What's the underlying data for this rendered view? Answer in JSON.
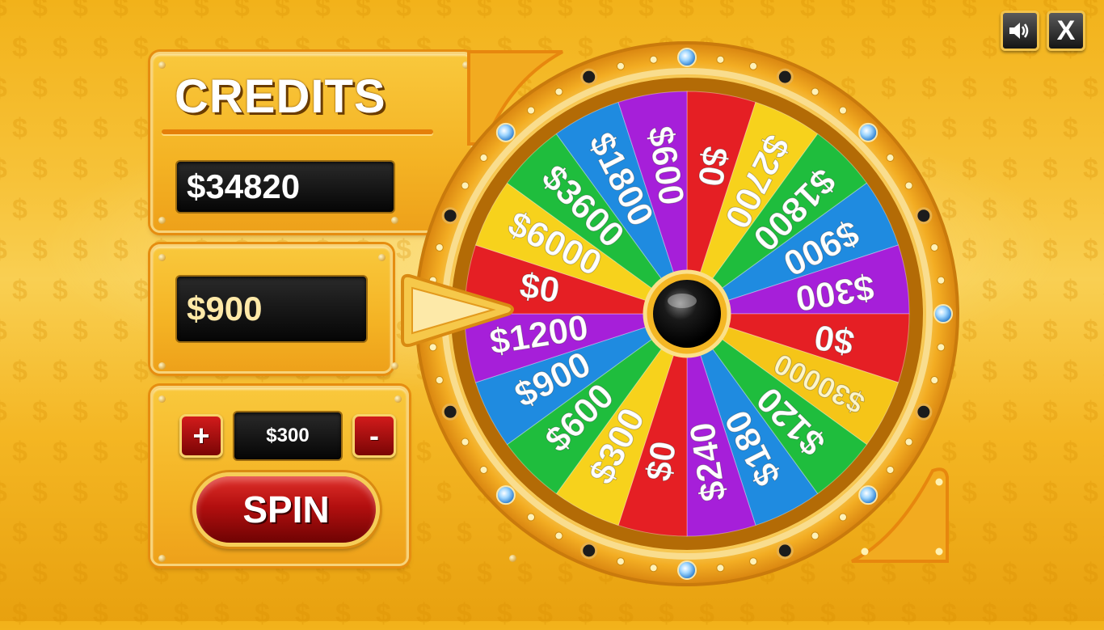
{
  "toolbar": {
    "sound_icon": "speaker-icon",
    "close_label": "X"
  },
  "credits_panel": {
    "title": "CREDITS",
    "credits": "$34820"
  },
  "win_panel": {
    "amount": "$900"
  },
  "bet_panel": {
    "plus_label": "+",
    "minus_label": "-",
    "bet": "$300",
    "spin_label": "SPIN"
  },
  "wheel": {
    "segments": [
      "$0",
      "$2700",
      "$1800",
      "$900",
      "$300",
      "$0",
      "$30000",
      "$120",
      "$180",
      "$240",
      "$0",
      "$300",
      "$600",
      "$900",
      "$1200",
      "$0",
      "$6000",
      "$3600",
      "$1800",
      "$600"
    ],
    "colors": [
      "#e51f24",
      "#f7d21c",
      "#1fbd3d",
      "#1f8be0",
      "#a61fd9",
      "#e51f24",
      "#f5c518",
      "#1fbd3d",
      "#1f8be0",
      "#a61fd9",
      "#e51f24",
      "#f7d21c",
      "#1fbd3d",
      "#1f8be0",
      "#a61fd9",
      "#e51f24",
      "#f7d21c",
      "#1fbd3d",
      "#1f8be0",
      "#a61fd9"
    ],
    "jackpot_color": "#f5c518"
  }
}
